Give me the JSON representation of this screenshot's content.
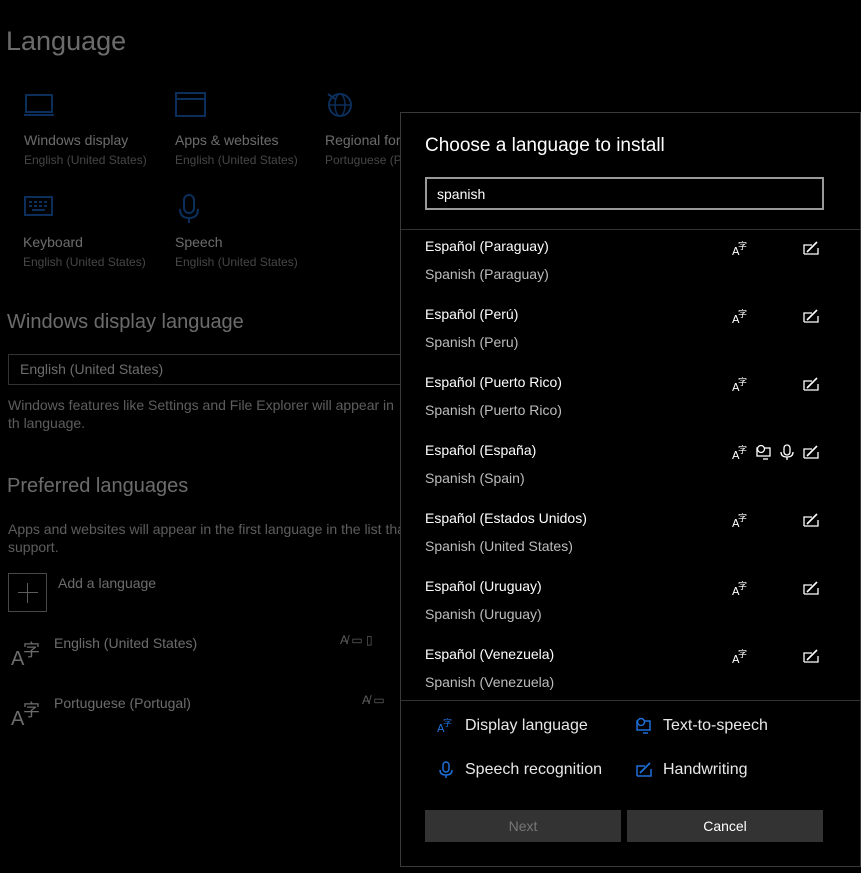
{
  "background": {
    "page_title": "Language",
    "tiles": [
      {
        "label": "Windows display",
        "sub": "English (United States)",
        "icon": "monitor-icon"
      },
      {
        "label": "Apps & websites",
        "sub": "English (United States)",
        "icon": "window-icon"
      },
      {
        "label": "Regional for",
        "sub": "Portuguese (Po",
        "icon": "globe-icon"
      },
      {
        "label": "Keyboard",
        "sub": "English (United States)",
        "icon": "keyboard-icon"
      },
      {
        "label": "Speech",
        "sub": "English (United States)",
        "icon": "microphone-icon"
      }
    ],
    "display_language_title": "Windows display language",
    "display_language_value": "English (United States)",
    "display_language_note": "Windows features like Settings and File Explorer will appear in th language.",
    "preferred_title": "Preferred languages",
    "preferred_note": "Apps and websites will appear in the first language in the list tha support.",
    "add_language": "Add a language",
    "languages": [
      {
        "name": "English (United States)"
      },
      {
        "name": "Portuguese (Portugal)"
      }
    ]
  },
  "dialog": {
    "title": "Choose a language to install",
    "search_value": "spanish",
    "items": [
      {
        "name": "Español (Paraguay)",
        "sub": "Spanish (Paraguay)",
        "tts": false,
        "speech": false
      },
      {
        "name": "Español (Perú)",
        "sub": "Spanish (Peru)",
        "tts": false,
        "speech": false
      },
      {
        "name": "Español (Puerto Rico)",
        "sub": "Spanish (Puerto Rico)",
        "tts": false,
        "speech": false
      },
      {
        "name": "Español (España)",
        "sub": "Spanish (Spain)",
        "tts": true,
        "speech": true
      },
      {
        "name": "Español (Estados Unidos)",
        "sub": "Spanish (United States)",
        "tts": false,
        "speech": false
      },
      {
        "name": "Español (Uruguay)",
        "sub": "Spanish (Uruguay)",
        "tts": false,
        "speech": false
      },
      {
        "name": "Español (Venezuela)",
        "sub": "Spanish (Venezuela)",
        "tts": false,
        "speech": false
      }
    ],
    "legend": {
      "display_language": "Display language",
      "text_to_speech": "Text-to-speech",
      "speech_recognition": "Speech recognition",
      "handwriting": "Handwriting"
    },
    "next_label": "Next",
    "cancel_label": "Cancel"
  },
  "colors": {
    "accent": "#1e6fd9",
    "dialog_bg": "#000000",
    "button_bg": "#333333"
  }
}
